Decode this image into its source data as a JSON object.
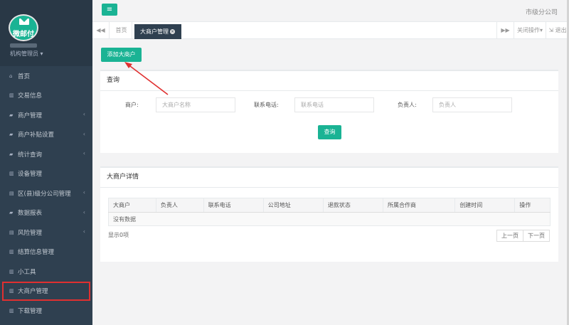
{
  "sidebar": {
    "logo_text": "微邮付",
    "role": "机构管理员",
    "items": [
      {
        "label": "首页",
        "icon": "home-icon",
        "glyph": "⌂",
        "has_arrow": false
      },
      {
        "label": "交易信息",
        "icon": "bar-chart-icon",
        "glyph": "▥",
        "has_arrow": false
      },
      {
        "label": "商户管理",
        "icon": "cart-icon",
        "glyph": "▰",
        "has_arrow": true
      },
      {
        "label": "商户补贴设置",
        "icon": "cart-icon",
        "glyph": "▰",
        "has_arrow": true
      },
      {
        "label": "统计查询",
        "icon": "cart-icon",
        "glyph": "▰",
        "has_arrow": true
      },
      {
        "label": "设备管理",
        "icon": "bar-chart-icon",
        "glyph": "▥",
        "has_arrow": false
      },
      {
        "label": "区(县)级分公司管理",
        "icon": "list-icon",
        "glyph": "▤",
        "has_arrow": true
      },
      {
        "label": "数据报表",
        "icon": "cart-icon",
        "glyph": "▰",
        "has_arrow": true
      },
      {
        "label": "风险管理",
        "icon": "list-icon",
        "glyph": "▤",
        "has_arrow": true
      },
      {
        "label": "结算信息管理",
        "icon": "bar-chart-icon",
        "glyph": "▥",
        "has_arrow": false
      },
      {
        "label": "小工具",
        "icon": "bar-chart-icon",
        "glyph": "▥",
        "has_arrow": false
      },
      {
        "label": "大商户管理",
        "icon": "bar-chart-icon",
        "glyph": "▥",
        "has_arrow": false
      },
      {
        "label": "下载管理",
        "icon": "bar-chart-icon",
        "glyph": "▥",
        "has_arrow": false
      }
    ]
  },
  "topbar": {
    "toggle_glyph": "≡",
    "company": "市级分公司"
  },
  "tabs": {
    "prev_glyph": "◀◀",
    "home": "首页",
    "active": "大商户管理",
    "close_glyph": "×",
    "next_glyph": "▶▶",
    "close_ops": "关闭操作▾",
    "logout": "退出"
  },
  "main": {
    "add_button": "添加大商户",
    "query": {
      "title": "查询",
      "merchant_label": "商户:",
      "merchant_placeholder": "大商户名称",
      "phone_label": "联系电话:",
      "phone_placeholder": "联系电话",
      "owner_label": "负责人:",
      "owner_placeholder": "负责人",
      "search_button": "查询"
    },
    "details": {
      "title": "大商户详情",
      "columns": [
        "大商户",
        "负责人",
        "联系电话",
        "公司地址",
        "退款状态",
        "所属合作商",
        "创建时间",
        "操作"
      ],
      "empty_text": "没有数据",
      "showing": "显示0项",
      "prev_page": "上一页",
      "next_page": "下一页"
    }
  },
  "colors": {
    "sidebar": "#2f4050",
    "accent": "#1ab394",
    "highlight_box": "#e03030"
  }
}
